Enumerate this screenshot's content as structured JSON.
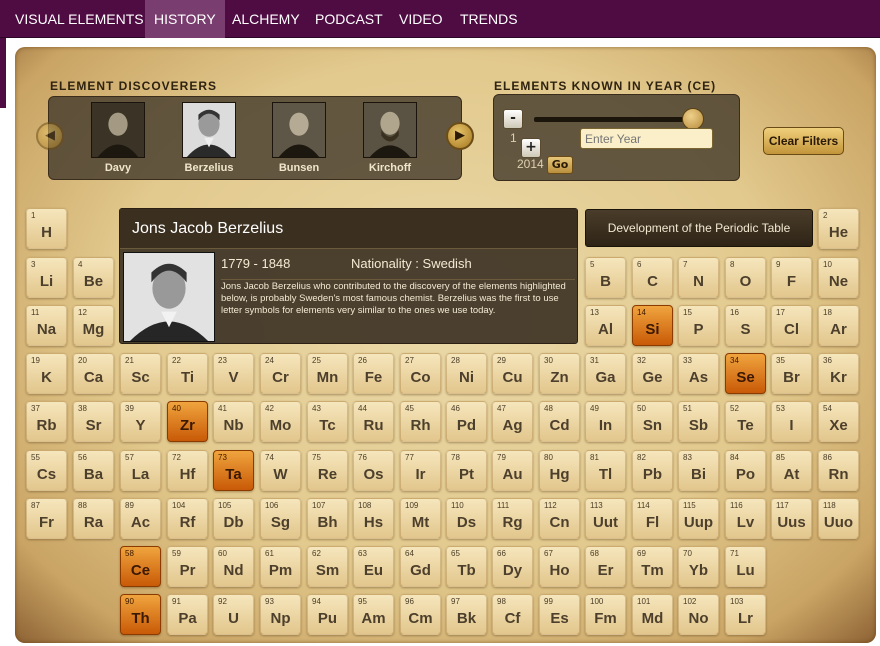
{
  "nav": {
    "tabs": [
      {
        "label": "VISUAL ELEMENTS",
        "active": false
      },
      {
        "label": "HISTORY",
        "active": true
      },
      {
        "label": "ALCHEMY",
        "active": false
      },
      {
        "label": "PODCAST",
        "active": false
      },
      {
        "label": "VIDEO",
        "active": false
      },
      {
        "label": "TRENDS",
        "active": false
      }
    ]
  },
  "discoverers": {
    "title": "ELEMENT DISCOVERERS",
    "prev_icon": "chevron-left-icon",
    "next_icon": "chevron-right-icon",
    "items": [
      {
        "name": "Davy",
        "selected": false
      },
      {
        "name": "Berzelius",
        "selected": true
      },
      {
        "name": "Bunsen",
        "selected": false
      },
      {
        "name": "Kirchoff",
        "selected": false
      }
    ]
  },
  "year_filter": {
    "title": "ELEMENTS KNOWN IN YEAR (CE)",
    "minus_label": "-",
    "plus_label": "+",
    "min_year": "1",
    "max_year": "2014",
    "slider_value": "2014",
    "placeholder": "Enter Year",
    "go_label": "Go",
    "clear_label": "Clear Filters"
  },
  "info": {
    "name": "Jons Jacob Berzelius",
    "dates": "1779 - 1848",
    "nationality": "Nationality : Swedish",
    "description": "Jons Jacob Berzelius who contributed to the discovery of the elements highlighted below, is probably Sweden's most famous chemist. Berzelius was the first to use letter symbols for elements very similar to the ones we use today."
  },
  "dev_button": "Development of the Periodic Table",
  "colors": {
    "nav_bg": "#4e0c43",
    "nav_active": "#7a3d6f",
    "highlight": "#d9730f",
    "tile": "#ecd7a6"
  },
  "elements": [
    {
      "n": "1",
      "s": "H"
    },
    {
      "n": "2",
      "s": "He"
    },
    {
      "n": "3",
      "s": "Li"
    },
    {
      "n": "4",
      "s": "Be"
    },
    {
      "n": "5",
      "s": "B"
    },
    {
      "n": "6",
      "s": "C"
    },
    {
      "n": "7",
      "s": "N"
    },
    {
      "n": "8",
      "s": "O"
    },
    {
      "n": "9",
      "s": "F"
    },
    {
      "n": "10",
      "s": "Ne"
    },
    {
      "n": "11",
      "s": "Na"
    },
    {
      "n": "12",
      "s": "Mg"
    },
    {
      "n": "13",
      "s": "Al"
    },
    {
      "n": "14",
      "s": "Si",
      "hl": true
    },
    {
      "n": "15",
      "s": "P"
    },
    {
      "n": "16",
      "s": "S"
    },
    {
      "n": "17",
      "s": "Cl"
    },
    {
      "n": "18",
      "s": "Ar"
    },
    {
      "n": "19",
      "s": "K"
    },
    {
      "n": "20",
      "s": "Ca"
    },
    {
      "n": "21",
      "s": "Sc"
    },
    {
      "n": "22",
      "s": "Ti"
    },
    {
      "n": "23",
      "s": "V"
    },
    {
      "n": "24",
      "s": "Cr"
    },
    {
      "n": "25",
      "s": "Mn"
    },
    {
      "n": "26",
      "s": "Fe"
    },
    {
      "n": "27",
      "s": "Co"
    },
    {
      "n": "28",
      "s": "Ni"
    },
    {
      "n": "29",
      "s": "Cu"
    },
    {
      "n": "30",
      "s": "Zn"
    },
    {
      "n": "31",
      "s": "Ga"
    },
    {
      "n": "32",
      "s": "Ge"
    },
    {
      "n": "33",
      "s": "As"
    },
    {
      "n": "34",
      "s": "Se",
      "hl": true
    },
    {
      "n": "35",
      "s": "Br"
    },
    {
      "n": "36",
      "s": "Kr"
    },
    {
      "n": "37",
      "s": "Rb"
    },
    {
      "n": "38",
      "s": "Sr"
    },
    {
      "n": "39",
      "s": "Y"
    },
    {
      "n": "40",
      "s": "Zr",
      "hl": true
    },
    {
      "n": "41",
      "s": "Nb"
    },
    {
      "n": "42",
      "s": "Mo"
    },
    {
      "n": "43",
      "s": "Tc"
    },
    {
      "n": "44",
      "s": "Ru"
    },
    {
      "n": "45",
      "s": "Rh"
    },
    {
      "n": "46",
      "s": "Pd"
    },
    {
      "n": "47",
      "s": "Ag"
    },
    {
      "n": "48",
      "s": "Cd"
    },
    {
      "n": "49",
      "s": "In"
    },
    {
      "n": "50",
      "s": "Sn"
    },
    {
      "n": "51",
      "s": "Sb"
    },
    {
      "n": "52",
      "s": "Te"
    },
    {
      "n": "53",
      "s": "I"
    },
    {
      "n": "54",
      "s": "Xe"
    },
    {
      "n": "55",
      "s": "Cs"
    },
    {
      "n": "56",
      "s": "Ba"
    },
    {
      "n": "57",
      "s": "La"
    },
    {
      "n": "72",
      "s": "Hf"
    },
    {
      "n": "73",
      "s": "Ta",
      "hl": true
    },
    {
      "n": "74",
      "s": "W"
    },
    {
      "n": "75",
      "s": "Re"
    },
    {
      "n": "76",
      "s": "Os"
    },
    {
      "n": "77",
      "s": "Ir"
    },
    {
      "n": "78",
      "s": "Pt"
    },
    {
      "n": "79",
      "s": "Au"
    },
    {
      "n": "80",
      "s": "Hg"
    },
    {
      "n": "81",
      "s": "Tl"
    },
    {
      "n": "82",
      "s": "Pb"
    },
    {
      "n": "83",
      "s": "Bi"
    },
    {
      "n": "84",
      "s": "Po"
    },
    {
      "n": "85",
      "s": "At"
    },
    {
      "n": "86",
      "s": "Rn"
    },
    {
      "n": "87",
      "s": "Fr"
    },
    {
      "n": "88",
      "s": "Ra"
    },
    {
      "n": "89",
      "s": "Ac"
    },
    {
      "n": "104",
      "s": "Rf"
    },
    {
      "n": "105",
      "s": "Db"
    },
    {
      "n": "106",
      "s": "Sg"
    },
    {
      "n": "107",
      "s": "Bh"
    },
    {
      "n": "108",
      "s": "Hs"
    },
    {
      "n": "109",
      "s": "Mt"
    },
    {
      "n": "110",
      "s": "Ds"
    },
    {
      "n": "111",
      "s": "Rg"
    },
    {
      "n": "112",
      "s": "Cn"
    },
    {
      "n": "113",
      "s": "Uut"
    },
    {
      "n": "114",
      "s": "Fl"
    },
    {
      "n": "115",
      "s": "Uup"
    },
    {
      "n": "116",
      "s": "Lv"
    },
    {
      "n": "117",
      "s": "Uus"
    },
    {
      "n": "118",
      "s": "Uuo"
    },
    {
      "n": "58",
      "s": "Ce",
      "hl": true
    },
    {
      "n": "59",
      "s": "Pr"
    },
    {
      "n": "60",
      "s": "Nd"
    },
    {
      "n": "61",
      "s": "Pm"
    },
    {
      "n": "62",
      "s": "Sm"
    },
    {
      "n": "63",
      "s": "Eu"
    },
    {
      "n": "64",
      "s": "Gd"
    },
    {
      "n": "65",
      "s": "Tb"
    },
    {
      "n": "66",
      "s": "Dy"
    },
    {
      "n": "67",
      "s": "Ho"
    },
    {
      "n": "68",
      "s": "Er"
    },
    {
      "n": "69",
      "s": "Tm"
    },
    {
      "n": "70",
      "s": "Yb"
    },
    {
      "n": "71",
      "s": "Lu"
    },
    {
      "n": "90",
      "s": "Th",
      "hl": true
    },
    {
      "n": "91",
      "s": "Pa"
    },
    {
      "n": "92",
      "s": "U"
    },
    {
      "n": "93",
      "s": "Np"
    },
    {
      "n": "94",
      "s": "Pu"
    },
    {
      "n": "95",
      "s": "Am"
    },
    {
      "n": "96",
      "s": "Cm"
    },
    {
      "n": "97",
      "s": "Bk"
    },
    {
      "n": "98",
      "s": "Cf"
    },
    {
      "n": "99",
      "s": "Es"
    },
    {
      "n": "100",
      "s": "Fm"
    },
    {
      "n": "101",
      "s": "Md"
    },
    {
      "n": "102",
      "s": "No"
    },
    {
      "n": "103",
      "s": "Lr"
    }
  ]
}
